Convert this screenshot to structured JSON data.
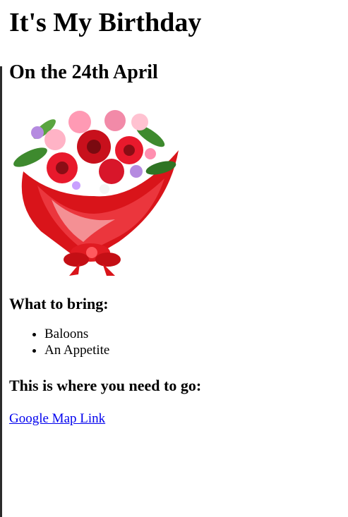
{
  "page": {
    "title": "It's My Birthday",
    "date_heading": "On the 24th April",
    "image_name": "flower-bouquet",
    "bring_heading": "What to bring:",
    "bring_items": [
      "Baloons",
      "An Appetite"
    ],
    "where_heading": "This is where you need to go:",
    "map_link_text": "Google Map Link"
  },
  "colors": {
    "link": "#0000ee",
    "text": "#000000",
    "bouquet_wrap": "#d9141a",
    "background": "#ffffff"
  }
}
